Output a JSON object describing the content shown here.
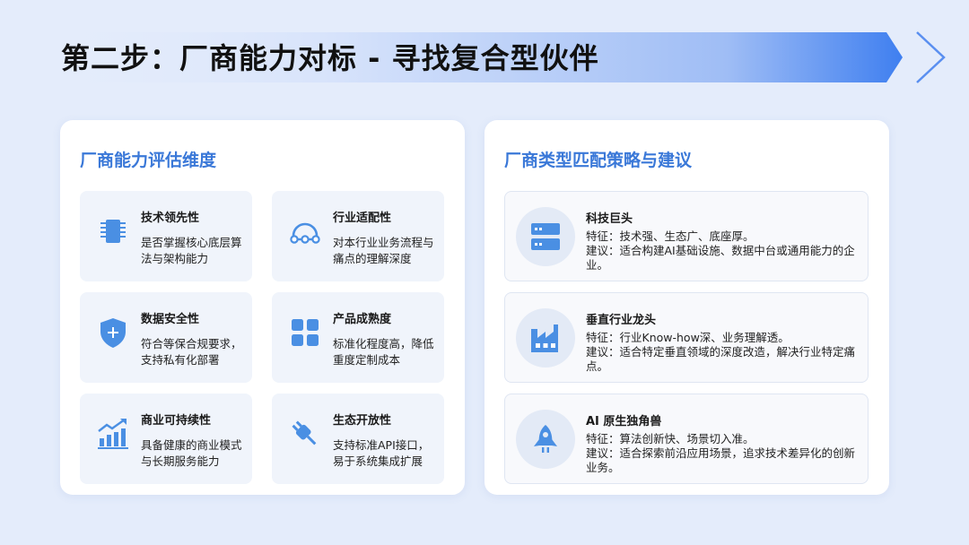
{
  "page": {
    "title": "第二步：厂商能力对标 - 寻找复合型伙伴"
  },
  "colors": {
    "accent": "#3a78d8",
    "icon_blue": "#4a8fe3",
    "background": "#e4ecfb",
    "card": "#ffffff",
    "tile": "#f0f4fb"
  },
  "left_card": {
    "title": "厂商能力评估维度",
    "items": [
      {
        "icon": "chip-icon",
        "name": "技术领先性",
        "desc": "是否掌握核心底层算法与架构能力"
      },
      {
        "icon": "arch-network-icon",
        "name": "行业适配性",
        "desc": "对本行业业务流程与痛点的理解深度"
      },
      {
        "icon": "shield-plus-icon",
        "name": "数据安全性",
        "desc": "符合等保合规要求，支持私有化部署"
      },
      {
        "icon": "grid-blocks-icon",
        "name": "产品成熟度",
        "desc": "标准化程度高，降低重度定制成本"
      },
      {
        "icon": "growth-chart-icon",
        "name": "商业可持续性",
        "desc": "具备健康的商业模式与长期服务能力"
      },
      {
        "icon": "plug-icon",
        "name": "生态开放性",
        "desc": "支持标准API接口，易于系统集成扩展"
      }
    ]
  },
  "right_card": {
    "title": "厂商类型匹配策略与建议",
    "vendors": [
      {
        "icon": "server-icon",
        "name": "科技巨头",
        "feature": "特征：技术强、生态广、底座厚。",
        "advice": "建议：适合构建AI基础设施、数据中台或通用能力的企业。"
      },
      {
        "icon": "factory-icon",
        "name": "垂直行业龙头",
        "feature": "特征：行业Know-how深、业务理解透。",
        "advice": "建议：适合特定垂直领域的深度改造，解决行业特定痛点。"
      },
      {
        "icon": "rocket-icon",
        "name": "AI 原生独角兽",
        "feature": "特征：算法创新快、场景切入准。",
        "advice": "建议：适合探索前沿应用场景，追求技术差异化的创新业务。"
      }
    ]
  }
}
